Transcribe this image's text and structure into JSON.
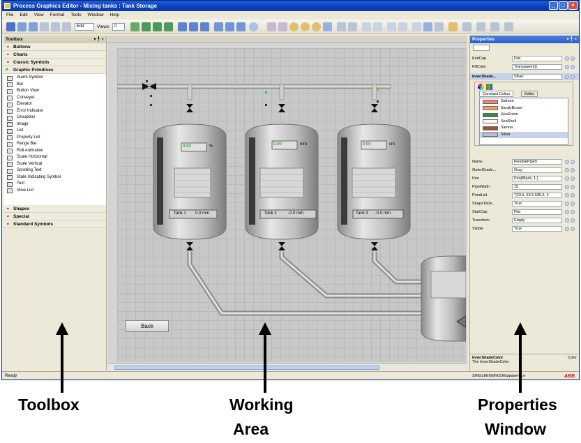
{
  "window": {
    "title": "Process Graphics Editor - Mixing tanks : Tank Storage",
    "controls": [
      "_",
      "□",
      "×"
    ]
  },
  "menu": [
    "File",
    "Edit",
    "View",
    "Format",
    "Tools",
    "Window",
    "Help"
  ],
  "toolbar": {
    "edit_combo": "Edit",
    "views_label": "Views",
    "views_combo": "0"
  },
  "toolbox": {
    "title": "Toolbox",
    "categories_top": [
      "Buttons",
      "Charts",
      "Classic Symbols",
      "Graphic Primitives"
    ],
    "tools": [
      "Alarm Symbol",
      "Bar",
      "Button View",
      "Conveyer",
      "Elevator",
      "Error Indicator",
      "Groupbox",
      "Image",
      "List",
      "Property List",
      "Range Bar",
      "Roll Animation",
      "Scale Horizontal",
      "Scale Vertical",
      "Scrolling Text",
      "State Indicating Symbol",
      "Text",
      "View List"
    ],
    "categories_bottom": [
      "Shapes",
      "Special",
      "Standard Symbols"
    ]
  },
  "canvas": {
    "tanks": [
      {
        "value": "0.00",
        "unit": "%",
        "label": "Tank 1",
        "level": "0.0 mm"
      },
      {
        "value": "0.00",
        "unit": "mm",
        "label": "Tank 2",
        "level": "-0.0 mm"
      },
      {
        "value": "0.00",
        "unit": "cm",
        "label": "Tank 3",
        "level": "-0.0 mm"
      }
    ],
    "back_button": "Back"
  },
  "properties": {
    "title": "Properties",
    "rows_top": [
      {
        "name": "EndCap",
        "value": "Flat"
      },
      {
        "name": "FillColor",
        "value": "Transparent()"
      },
      {
        "name": "InnerShade...",
        "value": "Silver"
      }
    ],
    "color_tabs": [
      "Constant Colors",
      "Editor"
    ],
    "colors": [
      {
        "name": "Salmon",
        "hex": "#fa8072"
      },
      {
        "name": "SandyBrown",
        "hex": "#f4a460"
      },
      {
        "name": "SeaGreen",
        "hex": "#2e8b57"
      },
      {
        "name": "SeaShell",
        "hex": "#fff5ee"
      },
      {
        "name": "Sienna",
        "hex": "#a0522d"
      },
      {
        "name": "Silver",
        "hex": "#c0c0c0"
      }
    ],
    "rows_bottom": [
      {
        "name": "Name",
        "value": "FlexiblePipe5"
      },
      {
        "name": "OuterShade...",
        "value": "Gray"
      },
      {
        "name": "Pen",
        "value": "Pen(Black, 1.)"
      },
      {
        "name": "PipeWidth",
        "value": "15."
      },
      {
        "name": "PointList",
        "value": "\"{33.5, 63.5  595.5, 4"
      },
      {
        "name": "SnapsToDe...",
        "value": "True"
      },
      {
        "name": "StartCap",
        "value": "Flat"
      },
      {
        "name": "Transform",
        "value": "Empty"
      },
      {
        "name": "Visible",
        "value": "True"
      }
    ],
    "desc_title": "InnerShadeColor",
    "desc_text": "The InnerShadeColor",
    "desc_right": "Color"
  },
  "status": {
    "left": "Ready",
    "right": "SINGLEENGNODE\\ppaservice",
    "brand": "ABB"
  },
  "captions": {
    "toolbox": "Toolbox",
    "working_area_1": "Working",
    "working_area_2": "Area",
    "properties_1": "Properties",
    "properties_2": "Window"
  }
}
